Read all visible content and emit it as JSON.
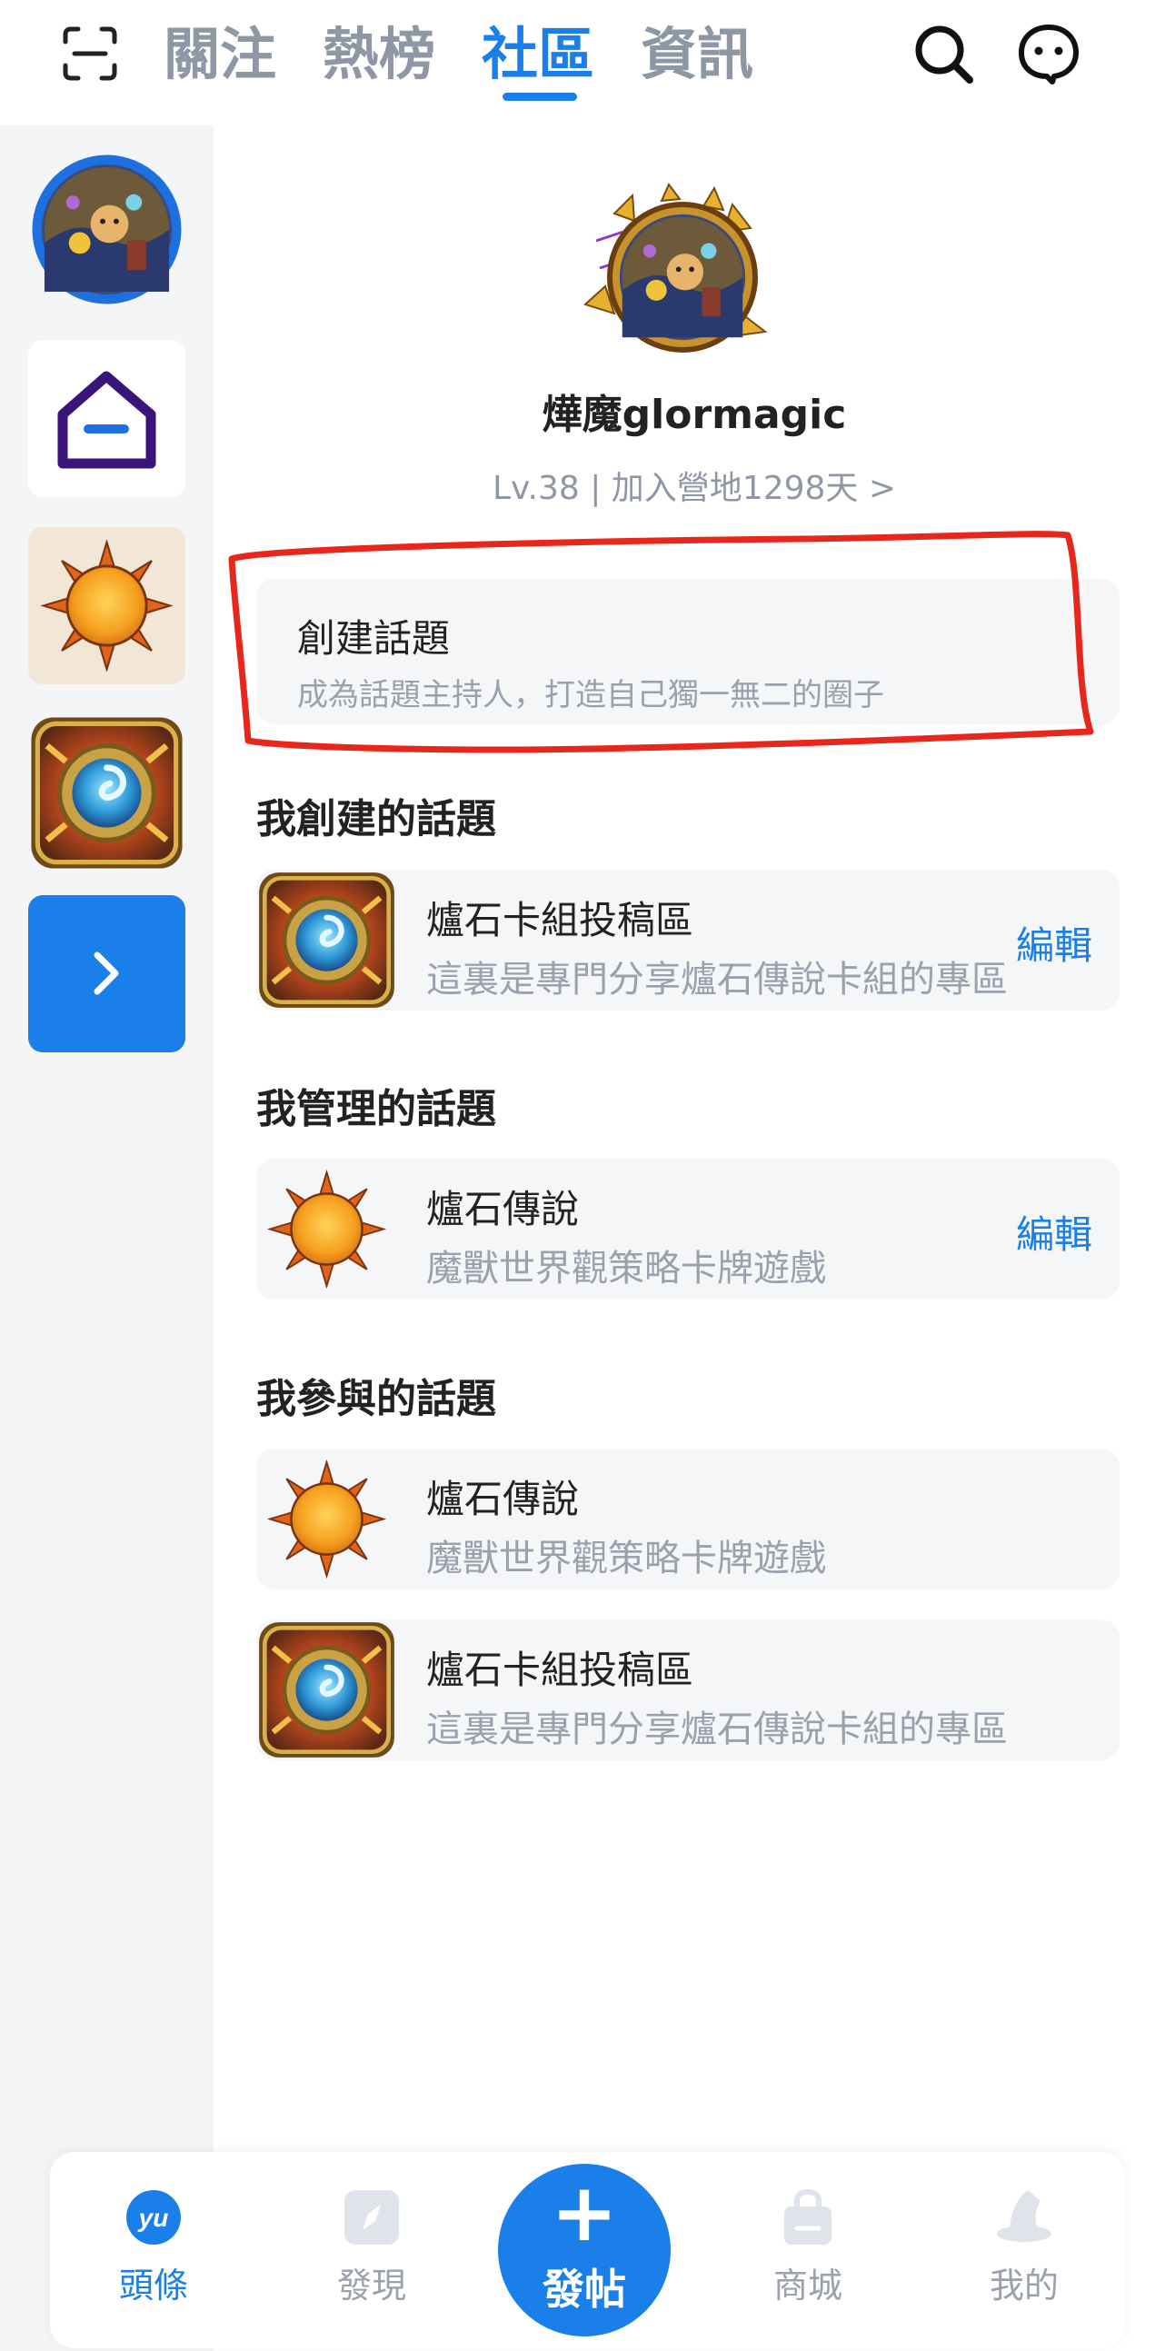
{
  "header": {
    "tabs": [
      {
        "label": "關注"
      },
      {
        "label": "熱榜"
      },
      {
        "label": "社區"
      },
      {
        "label": "資訊"
      }
    ],
    "active_tab": "社區"
  },
  "profile": {
    "name": "燁魔glormagic",
    "level_text": "Lv.38 | 加入營地1298天 >"
  },
  "create_topic": {
    "title": "創建話題",
    "subtitle": "成為話題主持人，打造自己獨一無二的圈子"
  },
  "sections": {
    "created": {
      "title": "我創建的話題",
      "items": [
        {
          "name": "爐石卡組投稿區",
          "desc": "這裏是專門分享爐石傳說卡組的專區",
          "edit": "編輯",
          "icon": "hearthstone-logo-icon"
        }
      ]
    },
    "managed": {
      "title": "我管理的話題",
      "items": [
        {
          "name": "爐石傳說",
          "desc": "魔獸世界觀策略卡牌遊戲",
          "edit": "編輯",
          "icon": "sun-icon"
        }
      ]
    },
    "joined": {
      "title": "我參與的話題",
      "items": [
        {
          "name": "爐石傳說",
          "desc": "魔獸世界觀策略卡牌遊戲",
          "icon": "sun-icon"
        },
        {
          "name": "爐石卡組投稿區",
          "desc": "這裏是專門分享爐石傳說卡組的專區",
          "icon": "hearthstone-logo-icon"
        }
      ]
    }
  },
  "bottom_nav": {
    "items": [
      {
        "label": "頭條",
        "icon": "yu-logo-icon"
      },
      {
        "label": "發現",
        "icon": "compass-icon"
      },
      {
        "label": "發帖",
        "icon": "plus-icon"
      },
      {
        "label": "商城",
        "icon": "shopping-bag-icon"
      },
      {
        "label": "我的",
        "icon": "wizard-hat-icon"
      }
    ]
  },
  "colors": {
    "accent": "#1a7fe8",
    "muted_text": "#8e97a6",
    "card_bg": "#f5f6f8",
    "rail_bg": "#f4f5f7",
    "highlight_red": "#e8271c"
  }
}
